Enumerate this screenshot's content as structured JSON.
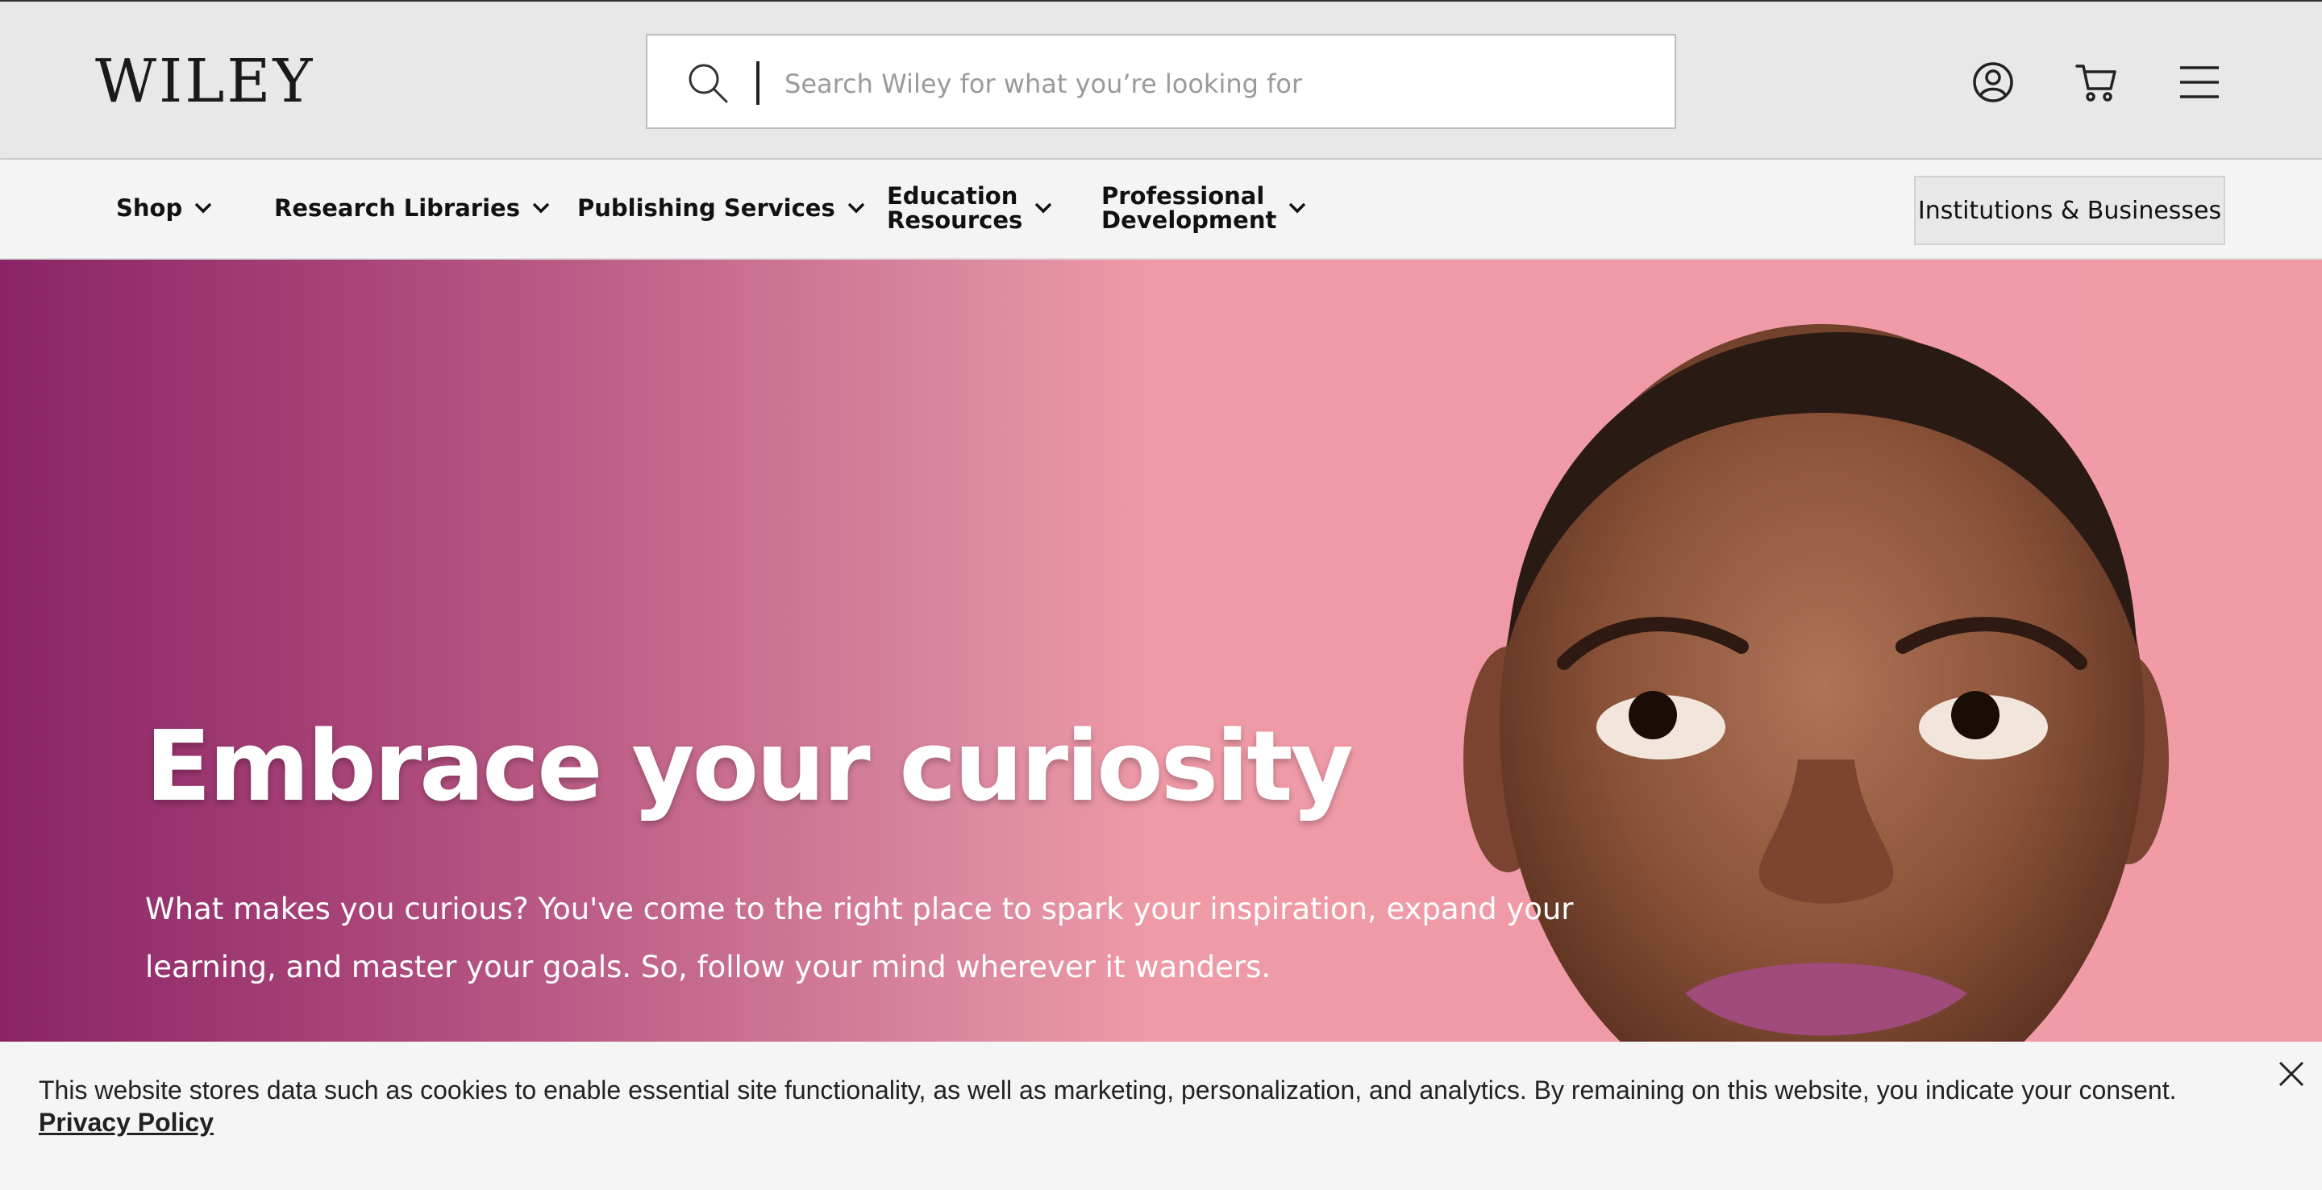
{
  "header": {
    "logo_text": "WILEY",
    "search_placeholder": "Search Wiley for what you’re looking for",
    "icons": [
      "search-icon",
      "account-icon",
      "cart-icon",
      "menu-icon"
    ]
  },
  "nav": {
    "items": [
      {
        "label": "Shop"
      },
      {
        "label": "Research Libraries"
      },
      {
        "label": "Publishing Services"
      },
      {
        "label": "Education\nResources"
      },
      {
        "label": "Professional\nDevelopment"
      }
    ],
    "cta_label": "Institutions & Businesses"
  },
  "hero": {
    "title": "Embrace your curiosity",
    "body": "What makes you curious? You've come to the right place to spark your inspiration, expand your learning, and master your goals. So, follow your mind wherever it wanders."
  },
  "cookie_banner": {
    "message": "This website stores data such as cookies to enable essential site functionality, as well as marketing, personalization, and analytics. By remaining on this website, you indicate your consent.",
    "policy_link": "Privacy Policy"
  },
  "colors": {
    "header_bg": "#e8e8e8",
    "nav_bg": "#f4f4f4",
    "hero_left": "#8a2466",
    "hero_right": "#f19ba7",
    "cookie_bg": "#f5f5f5"
  }
}
